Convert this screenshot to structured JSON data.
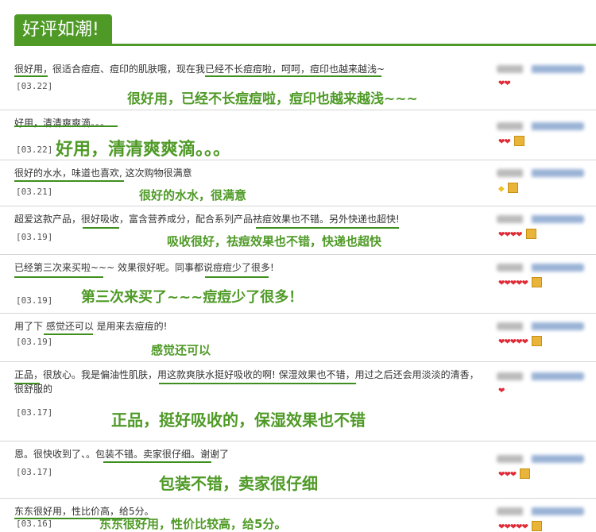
{
  "section_title": "好评如潮!",
  "reviews": [
    {
      "text": "很好用，很适合痘痘、痘印的肌肤哦，现在我已经不长痘痘啦，呵呵，痘印也越来越浅~",
      "date": "[03.22]",
      "highlight": "很好用，已经不长痘痘啦，痘印也越来越浅~~~",
      "rating": "❤❤"
    },
    {
      "text": "好用，清清爽爽滴。。。",
      "date": "[03.22]",
      "highlight": "好用，清清爽爽滴。。。",
      "rating": "❤❤"
    },
    {
      "text": "很好的水水，味道也喜欢, 这次购物很满意",
      "date": "[03.21]",
      "highlight": "很好的水水，很满意",
      "rating": "◆"
    },
    {
      "text": "超爱这款产品，很好吸收，富含营养成分，配合系列产品祛痘效果也不错。另外快递也超快!",
      "date": "[03.19]",
      "highlight": "吸收很好，祛痘效果也不错，快递也超快",
      "rating": "❤❤❤❤"
    },
    {
      "text": "已经第三次来买啦~~~ 效果很好呢。同事都说痘痘少了很多!",
      "date": "[03.19]",
      "highlight": "第三次来买了~~~痘痘少了很多！",
      "rating": "❤❤❤❤❤"
    },
    {
      "text": "用了下 感觉还可以 是用来去痘痘的!",
      "date": "[03.19]",
      "highlight": "感觉还可以",
      "rating": "❤❤❤❤❤"
    },
    {
      "text": "正品，很放心。我是偏油性肌肤，用这款爽肤水挺好吸收的啊! 保湿效果也不错，用过之后还会用淡淡的清香，很舒服的",
      "date": "[03.17]",
      "highlight": "正品，挺好吸收的，保湿效果也不错",
      "rating": "❤"
    },
    {
      "text": "恩。很快收到了、。包装不错。卖家很仔细。谢谢了",
      "date": "[03.17]",
      "highlight": "包装不错，卖家很仔细",
      "rating": "❤❤❤"
    },
    {
      "text": "东东很好用，性比价高，给5分。",
      "date": "[03.16]",
      "highlight": "东东很好用，性价比较高，给5分。",
      "rating": "❤❤❤❤❤"
    }
  ],
  "colors": {
    "accent": "#4f9a27",
    "underline": "#3f8f1f",
    "heart": "#e02a35"
  }
}
